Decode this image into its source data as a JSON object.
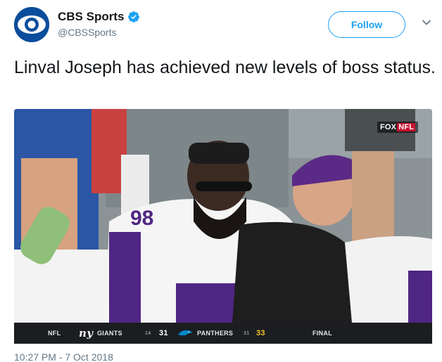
{
  "account": {
    "display_name": "CBS Sports",
    "handle": "@CBSSports",
    "verified": true,
    "avatar_icon": "cbs-eye-logo-icon"
  },
  "actions": {
    "follow_label": "Follow",
    "more_icon": "chevron-down-icon"
  },
  "tweet": {
    "text": "Linval Joseph has achieved new levels of boss status."
  },
  "media": {
    "network_bug_fox": "FOX",
    "network_bug_nfl": "NFL",
    "scorebar": {
      "league": "NFL",
      "team1_logo": "ny",
      "team1_name": "GIANTS",
      "team1_record": "14",
      "team1_score": "31",
      "team2_name": "PANTHERS",
      "team2_record": "31",
      "team2_score": "33",
      "status": "FINAL"
    }
  },
  "footer": {
    "timestamp": "10:27 PM - 7 Oct 2018"
  },
  "colors": {
    "accent": "#1da1f2",
    "text_primary": "#14171a",
    "text_secondary": "#657786",
    "cbs_blue": "#0a4d9c",
    "vikings_purple": "#4f2683"
  }
}
